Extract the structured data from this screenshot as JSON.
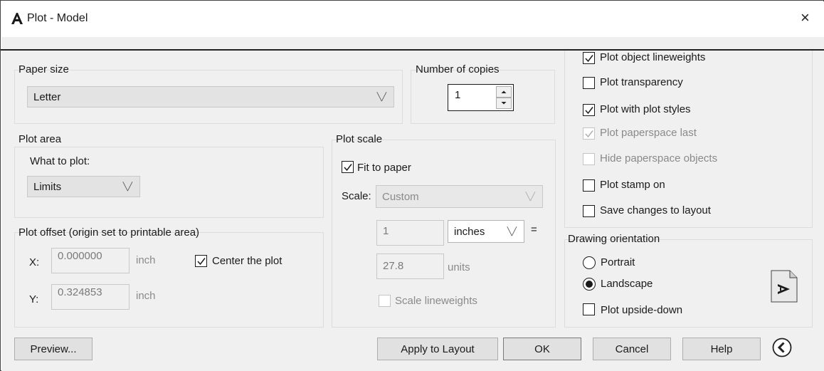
{
  "window": {
    "title": "Plot - Model",
    "close_glyph": "×",
    "app_icon": "autocad-a-icon"
  },
  "paper_size": {
    "group_label": "Paper size",
    "selected": "Letter"
  },
  "copies": {
    "group_label": "Number of copies",
    "value": "1"
  },
  "plot_area": {
    "group_label": "Plot area",
    "what_label": "What to plot:",
    "selected": "Limits"
  },
  "plot_offset": {
    "group_label": "Plot offset (origin set to printable area)",
    "x_label": "X:",
    "x_value": "0.000000",
    "x_unit": "inch",
    "y_label": "Y:",
    "y_value": "0.324853",
    "y_unit": "inch",
    "center_label": "Center the plot",
    "center_checked": true
  },
  "plot_scale": {
    "group_label": "Plot scale",
    "fit_label": "Fit to paper",
    "fit_checked": true,
    "scale_label": "Scale:",
    "scale_selected": "Custom",
    "value1": "1",
    "unit1": "inches",
    "equals": "=",
    "value2": "27.8",
    "unit2": "units",
    "lineweights_label": "Scale lineweights",
    "lineweights_checked": false
  },
  "plot_options": [
    {
      "label": "Plot object lineweights",
      "checked": true,
      "disabled": false
    },
    {
      "label": "Plot transparency",
      "checked": false,
      "disabled": false
    },
    {
      "label": "Plot with plot styles",
      "checked": true,
      "disabled": false
    },
    {
      "label": "Plot paperspace last",
      "checked": true,
      "disabled": true
    },
    {
      "label": "Hide paperspace objects",
      "checked": false,
      "disabled": true
    },
    {
      "label": "Plot stamp on",
      "checked": false,
      "disabled": false
    },
    {
      "label": "Save changes to layout",
      "checked": false,
      "disabled": false
    }
  ],
  "orientation": {
    "group_label": "Drawing orientation",
    "portrait_label": "Portrait",
    "landscape_label": "Landscape",
    "selected": "Landscape",
    "upside_down_label": "Plot upside-down",
    "upside_down_checked": false,
    "preview_glyph": "A"
  },
  "buttons": {
    "preview": "Preview...",
    "apply": "Apply to Layout",
    "ok": "OK",
    "cancel": "Cancel",
    "help": "Help",
    "collapse_glyph": "<"
  }
}
